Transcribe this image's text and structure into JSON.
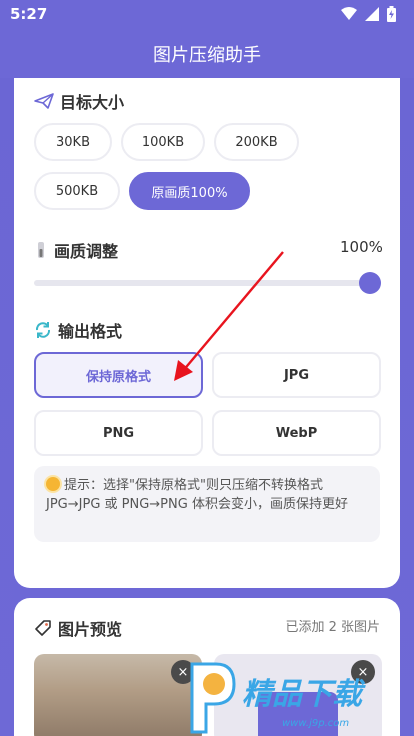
{
  "status_bar": {
    "time": "5:27"
  },
  "header": {
    "title": "图片压缩助手"
  },
  "target_size": {
    "title": "目标大小",
    "options": [
      "30KB",
      "100KB",
      "200KB",
      "500KB",
      "原画质100%"
    ],
    "selected": "原画质100%"
  },
  "quality": {
    "title": "画质调整",
    "value_label": "100%",
    "value": 100
  },
  "output_format": {
    "title": "输出格式",
    "options": [
      "保持原格式",
      "JPG",
      "PNG",
      "WebP"
    ],
    "selected": "保持原格式",
    "tip": "提示：选择\"保持原格式\"则只压缩不转换格式 JPG→JPG 或 PNG→PNG 体积会变小，画质保持更好"
  },
  "preview": {
    "title": "图片预览",
    "count_label": "已添加 2 张图片",
    "close_label": "×"
  },
  "watermark": {
    "brand": "精品下载",
    "url": "www.j9p.com"
  },
  "colors": {
    "accent": "#6d68d6",
    "annotation_arrow": "#e8141e"
  }
}
